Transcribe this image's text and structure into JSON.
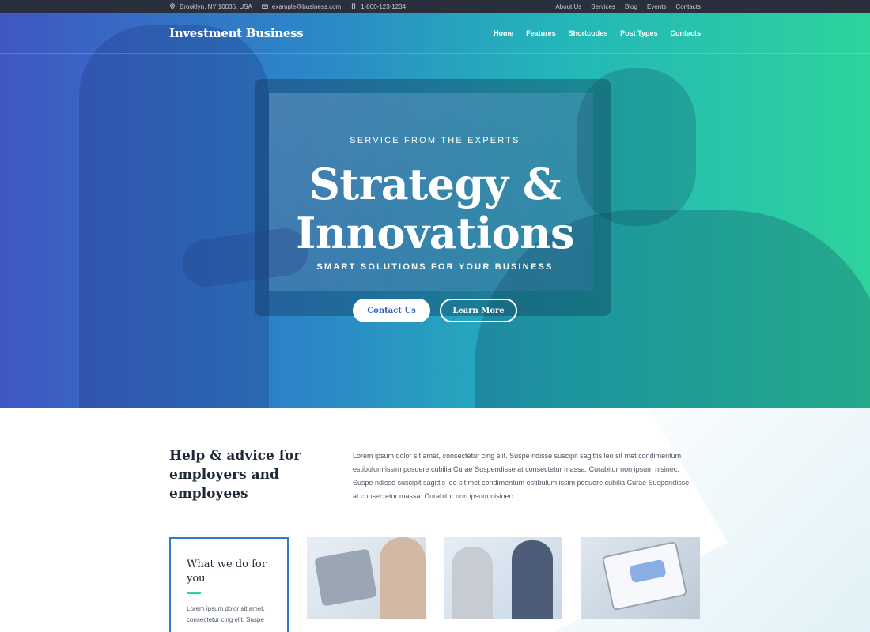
{
  "topbar": {
    "address": "Brooklyn, NY 10036, USA",
    "email": "example@business.com",
    "phone": "1-800-123-1234",
    "links": [
      "About Us",
      "Services",
      "Blog",
      "Events",
      "Contacts"
    ]
  },
  "header": {
    "logo": "Investment Business",
    "nav": [
      "Home",
      "Features",
      "Shortcodes",
      "Post Types",
      "Contacts"
    ]
  },
  "hero": {
    "eyebrow": "SERVICE FROM THE EXPERTS",
    "headline_line1": "Strategy &",
    "headline_line2": "Innovations",
    "subline": "SMART SOLUTIONS FOR YOUR BUSINESS",
    "primary_button": "Contact Us",
    "secondary_button": "Learn More"
  },
  "intro": {
    "title": "Help & advice for employers and employees",
    "text": "Lorem ipsum dolor sit amet, consectetur cing elit. Suspe ndisse suscipit sagittis leo sit met condimentum estibulum issim posuere cubilia Curae Suspendisse at consectetur massa. Curabitur non ipsum nisinec. Suspe ndisse suscipit sagittis leo sit met condimentum estibulum issim posuere cubilia Curae Suspendisse at consectetur massa. Curabitur non ipsum nisinec"
  },
  "cards": {
    "what_we_do_title": "What we do for you",
    "what_we_do_text": "Lorem ipsum dolor sit amet, consectetur cing elit. Suspe"
  },
  "colors": {
    "accent_blue": "#2f7cc9",
    "accent_green": "#2ed39c",
    "topbar_bg": "#2a2f3d"
  }
}
